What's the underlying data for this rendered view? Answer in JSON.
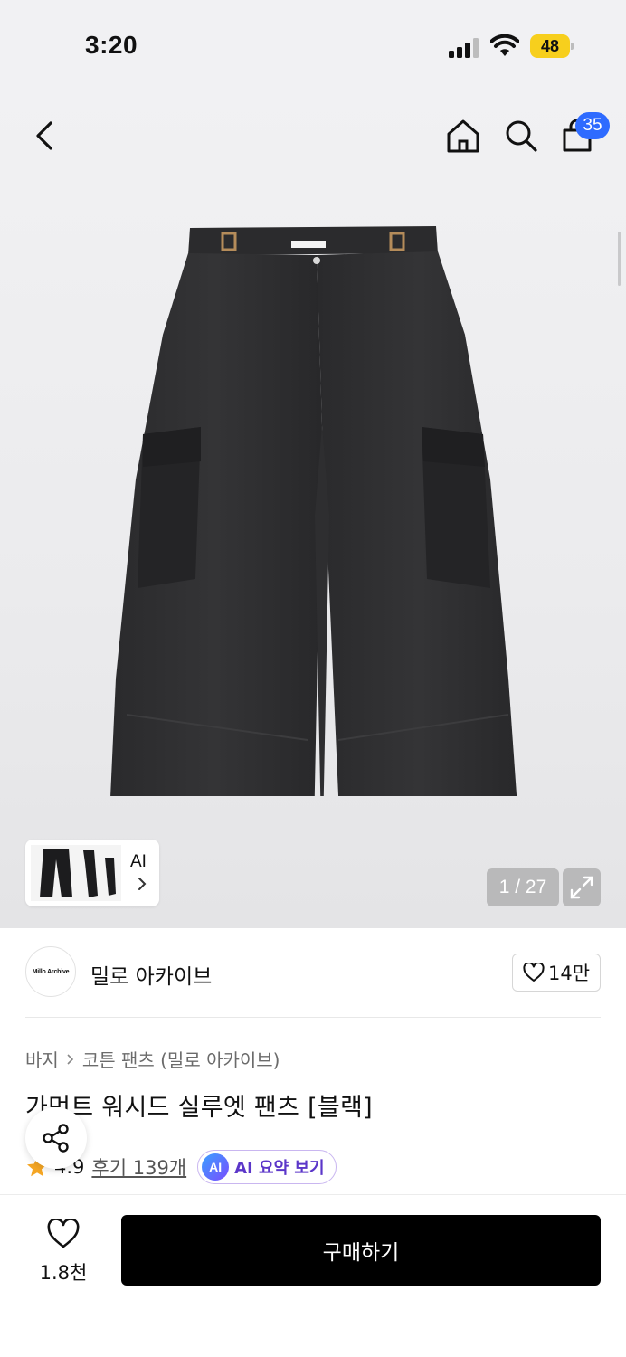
{
  "status_bar": {
    "time": "3:20",
    "battery": "48"
  },
  "nav": {
    "cart_count": "35"
  },
  "gallery": {
    "counter": "1 / 27",
    "ai_label": "AI"
  },
  "brand": {
    "logo_text": "Millo Archive",
    "name": "밀로 아카이브",
    "likes": "14만"
  },
  "product": {
    "breadcrumb": [
      "바지",
      "코튼 팬츠 (밀로 아카이브)"
    ],
    "title": "가먼트 워시드 실루엣 팬츠 [블랙]",
    "rating": "4.9",
    "reviews": "후기 139개",
    "ai_summary_badge": "AI",
    "ai_summary_label": "AI 요약 보기"
  },
  "bottom_bar": {
    "wish_count": "1.8천",
    "buy_label": "구매하기"
  },
  "colors": {
    "accent_blue": "#2e6bff",
    "battery_yellow": "#f7cf1d",
    "star": "#f5a623",
    "ai_purple": "#5b36c9",
    "buy_bg": "#000000"
  },
  "icons": [
    "back-icon",
    "home-icon",
    "search-icon",
    "bag-icon",
    "expand-icon",
    "heart-icon",
    "share-icon",
    "star-icon",
    "chevron-right-icon"
  ]
}
